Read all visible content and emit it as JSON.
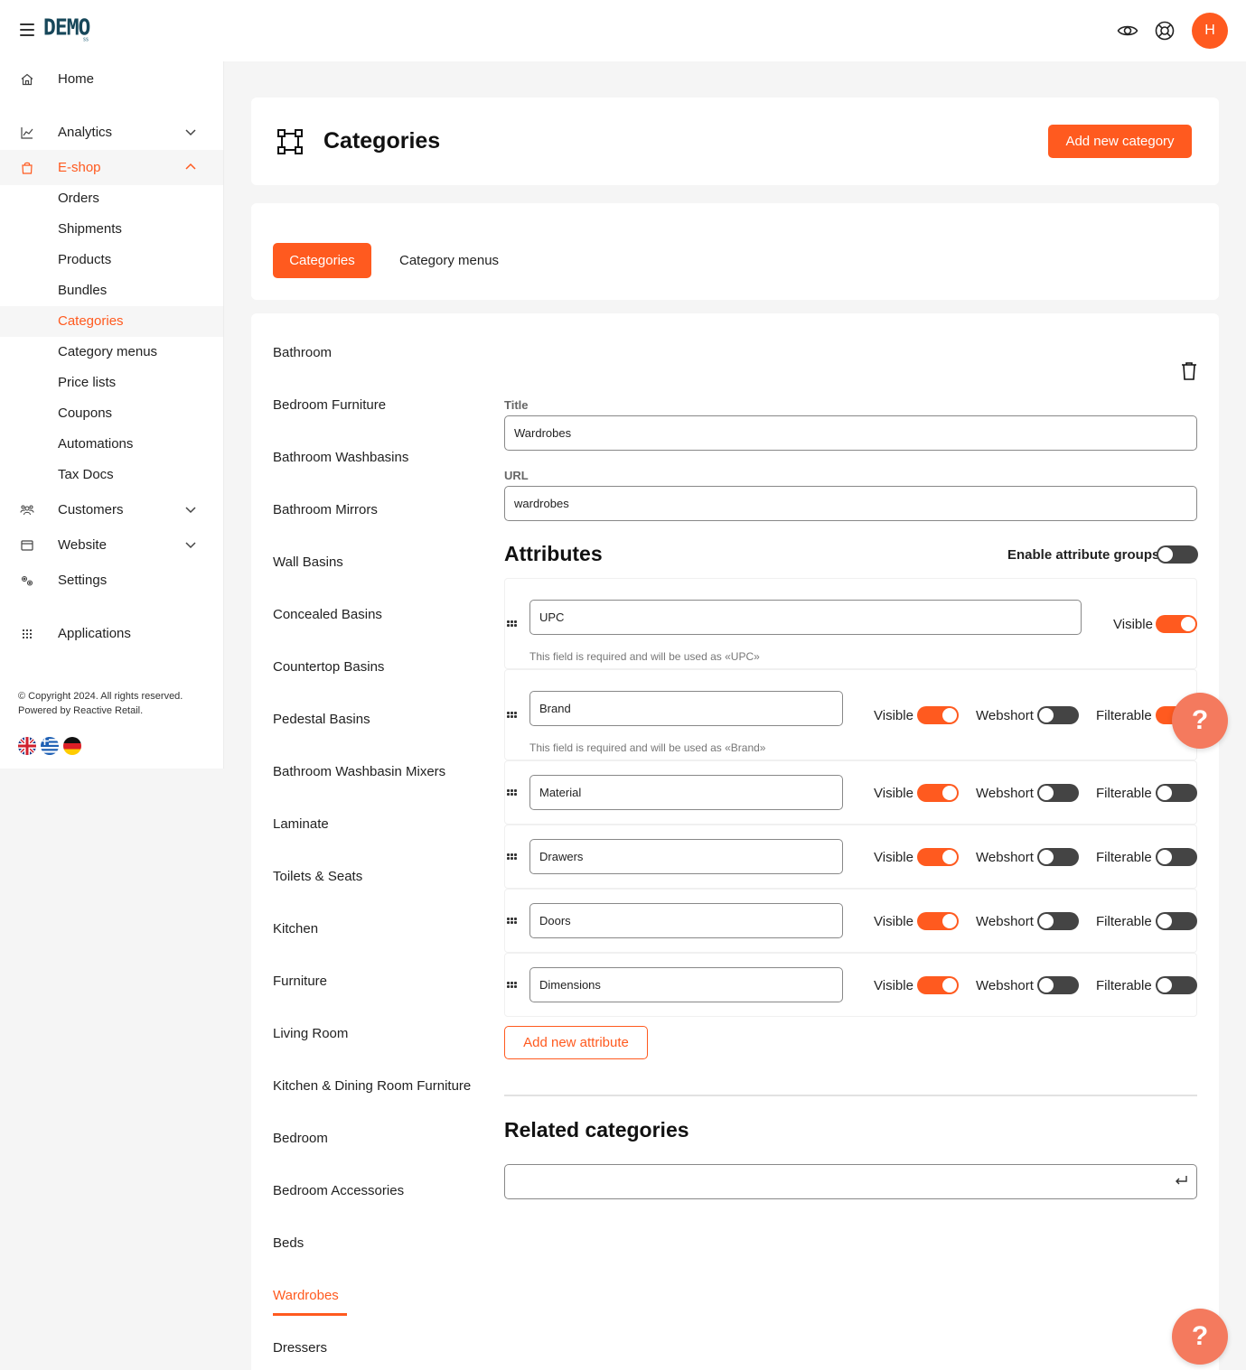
{
  "app": {
    "logo_text": "DEMO",
    "logo_sub": "SS",
    "avatar_initial": "H"
  },
  "sidebar": {
    "items": [
      {
        "label": "Home",
        "icon": "home-icon"
      },
      {
        "label": "Analytics",
        "icon": "chart-icon"
      },
      {
        "label": "E-shop",
        "icon": "shopping-bag-icon"
      },
      {
        "label": "Customers",
        "icon": "users-icon"
      },
      {
        "label": "Website",
        "icon": "browser-icon"
      },
      {
        "label": "Settings",
        "icon": "gears-icon"
      },
      {
        "label": "Applications",
        "icon": "grid-icon"
      }
    ],
    "eshop_sub": [
      "Orders",
      "Shipments",
      "Products",
      "Bundles",
      "Categories",
      "Category menus",
      "Price lists",
      "Coupons",
      "Automations",
      "Tax Docs"
    ],
    "copyright_line1": "© Copyright 2024. All rights reserved.",
    "copyright_line2": "Powered by Reactive Retail.",
    "languages": [
      "English",
      "Greek",
      "German"
    ]
  },
  "header": {
    "title": "Categories",
    "add_button": "Add new category"
  },
  "tabs": {
    "active": "Categories",
    "other": "Category menus"
  },
  "categories": [
    "Bathroom",
    "Bedroom Furniture",
    "Bathroom Washbasins",
    "Bathroom Mirrors",
    "Wall Basins",
    "Concealed Basins",
    "Countertop Basins",
    "Pedestal Basins",
    "Bathroom Washbasin Mixers",
    "Laminate",
    "Toilets & Seats",
    "Kitchen",
    "Furniture",
    "Living Room",
    "Kitchen & Dining Room Furniture",
    "Bedroom",
    "Bedroom Accessories",
    "Beds",
    "Wardrobes",
    "Dressers"
  ],
  "selected_category": "Wardrobes",
  "form": {
    "title_label": "Title",
    "title_value": "Wardrobes",
    "url_label": "URL",
    "url_value": "wardrobes",
    "attributes_title": "Attributes",
    "enable_groups_label": "Enable attribute groups",
    "enable_groups_on": false,
    "visible_label": "Visible",
    "webshort_label": "Webshort",
    "filterable_label": "Filterable",
    "attributes": [
      {
        "name": "UPC",
        "visible": true,
        "hint": "This field is required and will be used as «UPC»"
      },
      {
        "name": "Brand",
        "visible": true,
        "webshort": false,
        "filterable": true,
        "hint": "This field is required and will be used as «Brand»"
      },
      {
        "name": "Material",
        "visible": true,
        "webshort": false,
        "filterable": false
      },
      {
        "name": "Drawers",
        "visible": true,
        "webshort": false,
        "filterable": false
      },
      {
        "name": "Doors",
        "visible": true,
        "webshort": false,
        "filterable": false
      },
      {
        "name": "Dimensions",
        "visible": true,
        "webshort": false,
        "filterable": false
      }
    ],
    "add_attribute_button": "Add new attribute",
    "related_title": "Related categories",
    "related_value": ""
  },
  "help_label": "?",
  "colors": {
    "accent": "#ff5a1f",
    "logo": "#17475a",
    "help": "#f47a5e"
  }
}
